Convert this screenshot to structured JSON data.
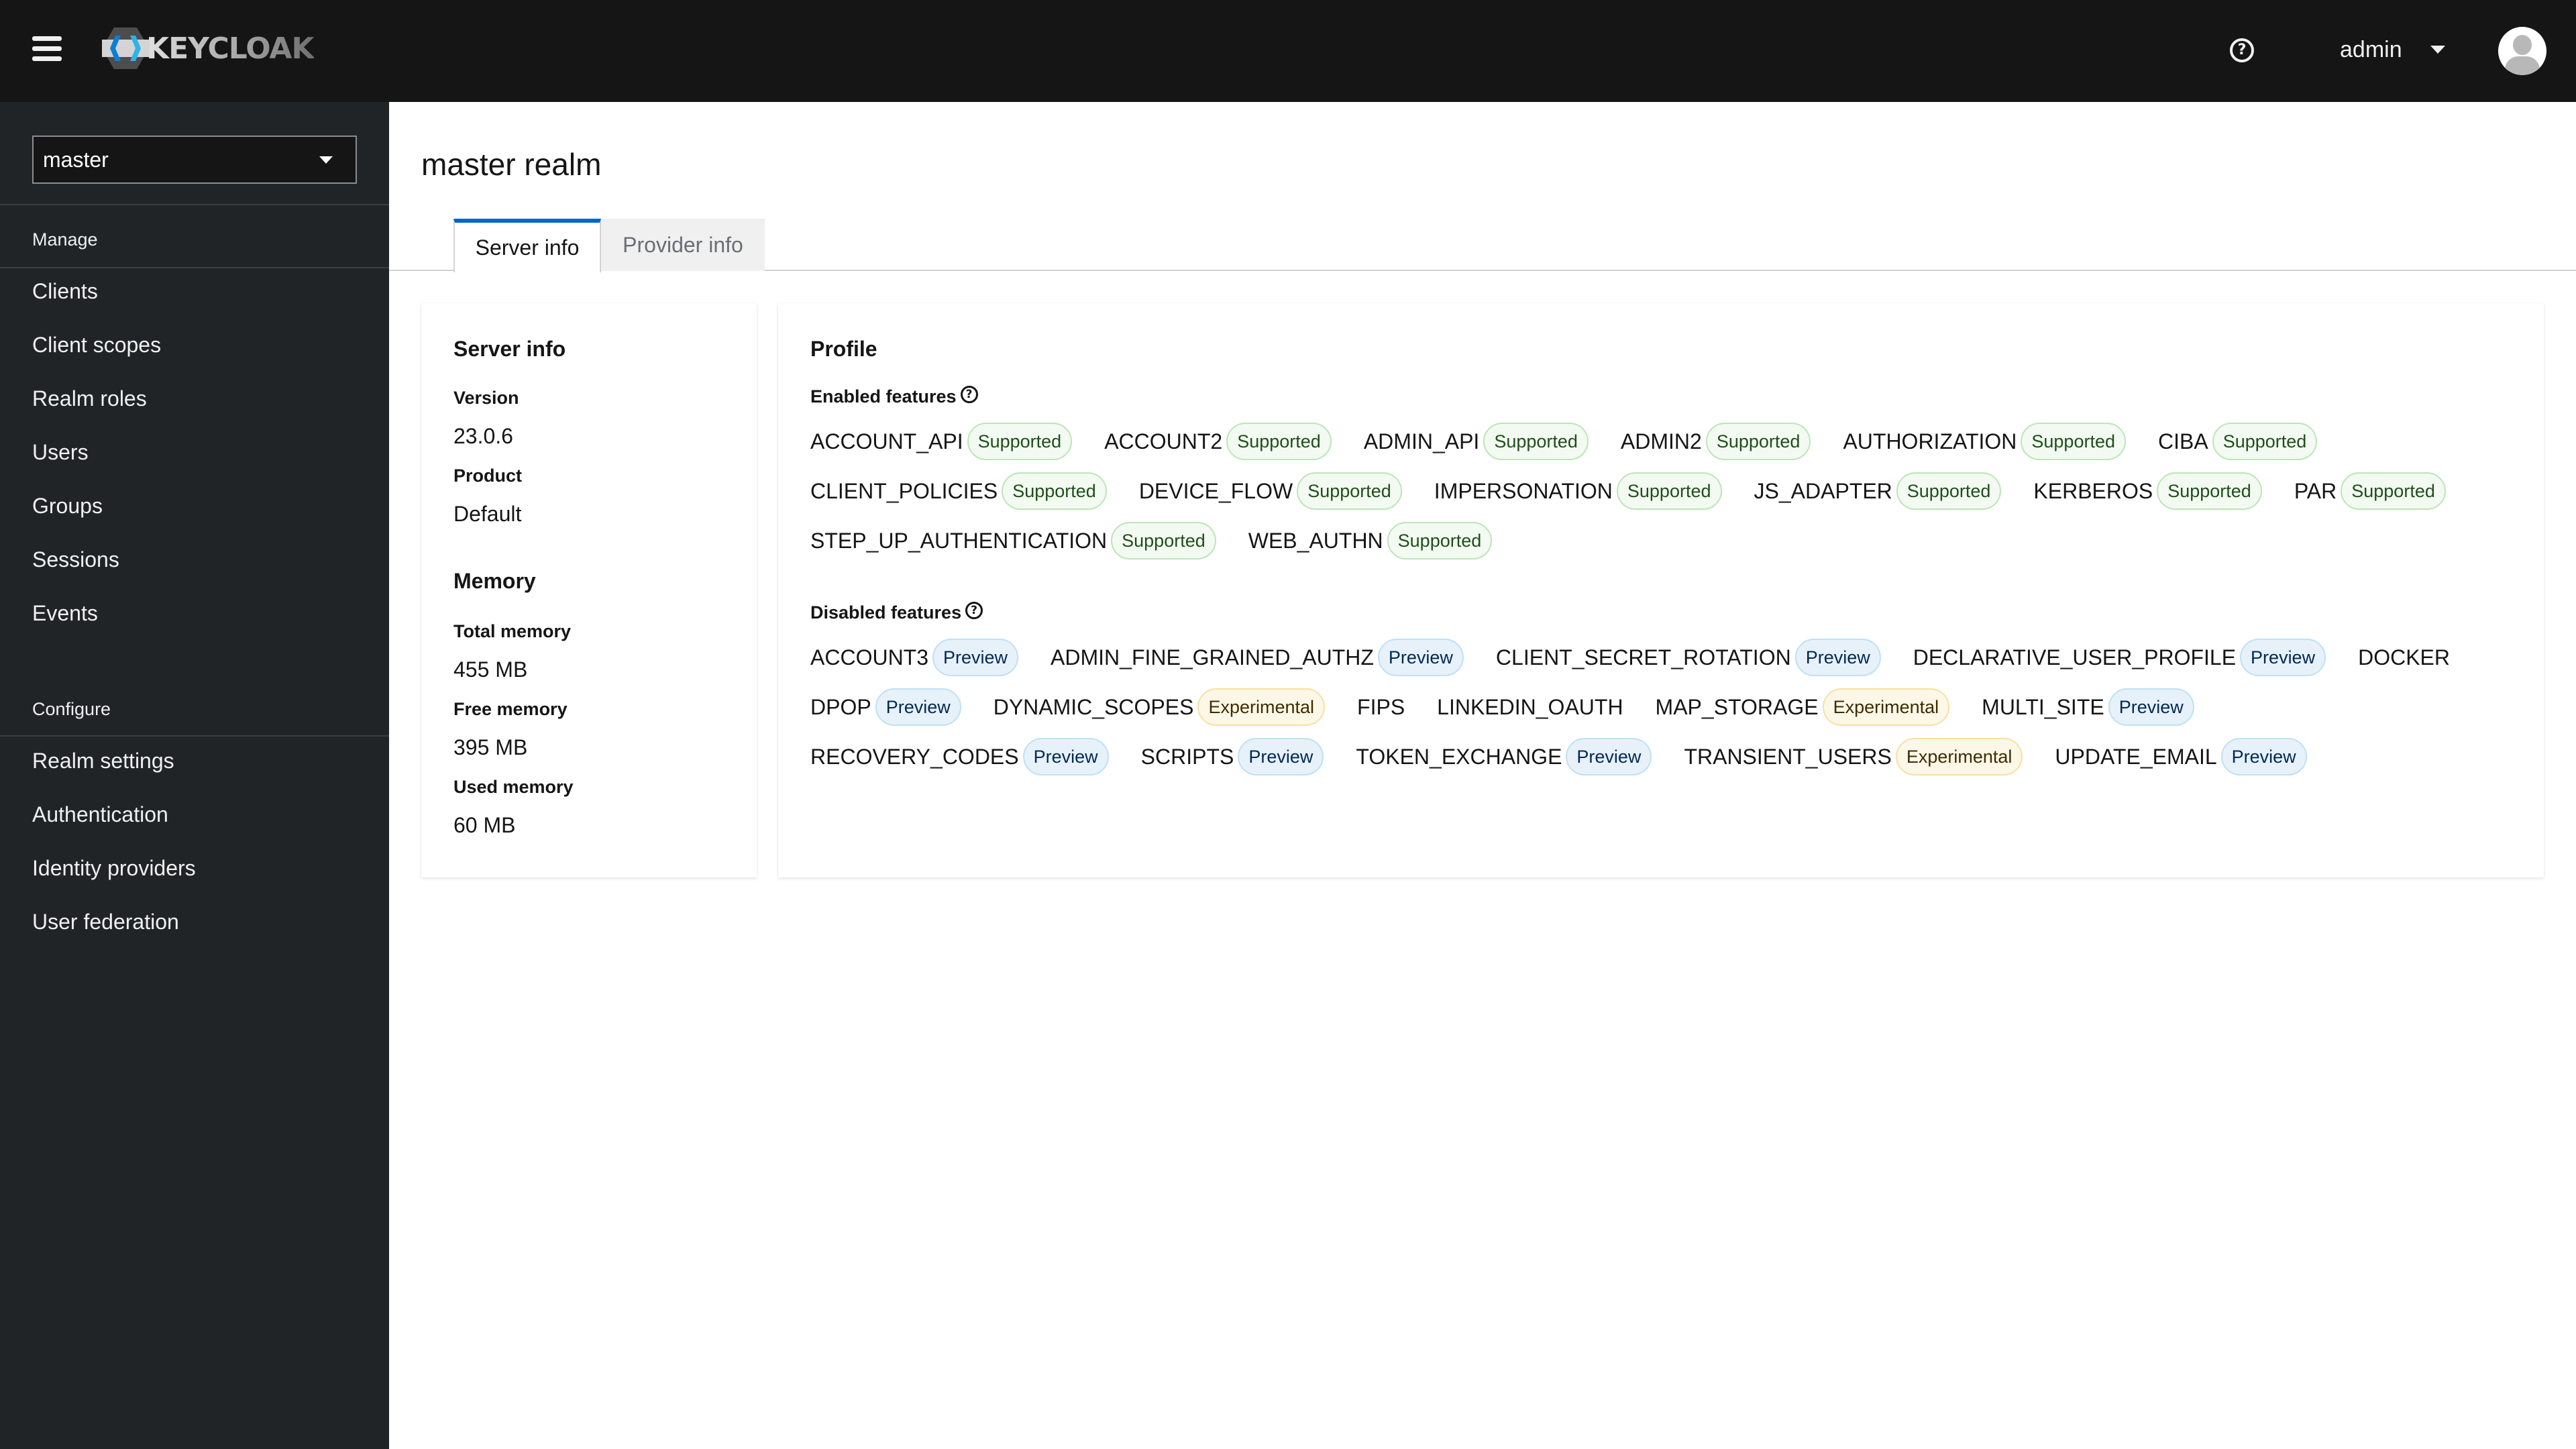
{
  "header": {
    "brand": "KEYCLOAK",
    "help_icon": "help-circle-icon",
    "user_name": "admin",
    "avatar_icon": "user-avatar-icon"
  },
  "sidebar": {
    "realm_selector": "master",
    "groups": [
      {
        "title": "Manage",
        "items": [
          "Clients",
          "Client scopes",
          "Realm roles",
          "Users",
          "Groups",
          "Sessions",
          "Events"
        ]
      },
      {
        "title": "Configure",
        "items": [
          "Realm settings",
          "Authentication",
          "Identity providers",
          "User federation"
        ]
      }
    ]
  },
  "main": {
    "title": "master realm",
    "tabs": [
      {
        "label": "Server info",
        "active": true
      },
      {
        "label": "Provider info",
        "active": false
      }
    ],
    "server_info": {
      "title": "Server info",
      "version_label": "Version",
      "version": "23.0.6",
      "product_label": "Product",
      "product": "Default",
      "memory_title": "Memory",
      "total_label": "Total memory",
      "total": "455 MB",
      "free_label": "Free memory",
      "free": "395 MB",
      "used_label": "Used memory",
      "used": "60 MB"
    },
    "profile": {
      "title": "Profile",
      "enabled_heading": "Enabled features",
      "enabled_rows": [
        [
          {
            "name": "ACCOUNT_API",
            "badge": "Supported",
            "type": "supported"
          },
          {
            "name": "ACCOUNT2",
            "badge": "Supported",
            "type": "supported"
          },
          {
            "name": "ADMIN_API",
            "badge": "Supported",
            "type": "supported"
          },
          {
            "name": "ADMIN2",
            "badge": "Supported",
            "type": "supported"
          },
          {
            "name": "AUTHORIZATION",
            "badge": "Supported",
            "type": "supported"
          },
          {
            "name": "CIBA",
            "badge": "Supported",
            "type": "supported"
          }
        ],
        [
          {
            "name": "CLIENT_POLICIES",
            "badge": "Supported",
            "type": "supported"
          },
          {
            "name": "DEVICE_FLOW",
            "badge": "Supported",
            "type": "supported"
          },
          {
            "name": "IMPERSONATION",
            "badge": "Supported",
            "type": "supported"
          },
          {
            "name": "JS_ADAPTER",
            "badge": "Supported",
            "type": "supported"
          },
          {
            "name": "KERBEROS",
            "badge": "Supported",
            "type": "supported"
          },
          {
            "name": "PAR",
            "badge": "Supported",
            "type": "supported"
          }
        ],
        [
          {
            "name": "STEP_UP_AUTHENTICATION",
            "badge": "Supported",
            "type": "supported"
          },
          {
            "name": "WEB_AUTHN",
            "badge": "Supported",
            "type": "supported"
          }
        ]
      ],
      "disabled_heading": "Disabled features",
      "disabled_rows": [
        [
          {
            "name": "ACCOUNT3",
            "badge": "Preview",
            "type": "preview"
          },
          {
            "name": "ADMIN_FINE_GRAINED_AUTHZ",
            "badge": "Preview",
            "type": "preview"
          },
          {
            "name": "CLIENT_SECRET_ROTATION",
            "badge": "Preview",
            "type": "preview"
          },
          {
            "name": "DECLARATIVE_USER_PROFILE",
            "badge": "Preview",
            "type": "preview"
          },
          {
            "name": "DOCKER",
            "badge": null,
            "type": null
          }
        ],
        [
          {
            "name": "DPOP",
            "badge": "Preview",
            "type": "preview"
          },
          {
            "name": "DYNAMIC_SCOPES",
            "badge": "Experimental",
            "type": "experimental"
          },
          {
            "name": "FIPS",
            "badge": null,
            "type": null
          },
          {
            "name": "LINKEDIN_OAUTH",
            "badge": null,
            "type": null
          },
          {
            "name": "MAP_STORAGE",
            "badge": "Experimental",
            "type": "experimental"
          },
          {
            "name": "MULTI_SITE",
            "badge": "Preview",
            "type": "preview"
          }
        ],
        [
          {
            "name": "RECOVERY_CODES",
            "badge": "Preview",
            "type": "preview"
          },
          {
            "name": "SCRIPTS",
            "badge": "Preview",
            "type": "preview"
          },
          {
            "name": "TOKEN_EXCHANGE",
            "badge": "Preview",
            "type": "preview"
          },
          {
            "name": "TRANSIENT_USERS",
            "badge": "Experimental",
            "type": "experimental"
          },
          {
            "name": "UPDATE_EMAIL",
            "badge": "Preview",
            "type": "preview"
          }
        ]
      ]
    }
  },
  "colors": {
    "masthead": "#151515",
    "sidebar": "#212427",
    "tab_accent": "#0066cc",
    "supported_bg": "#f3faf2",
    "preview_bg": "#e7f1fa",
    "experimental_bg": "#fdf7e7"
  }
}
